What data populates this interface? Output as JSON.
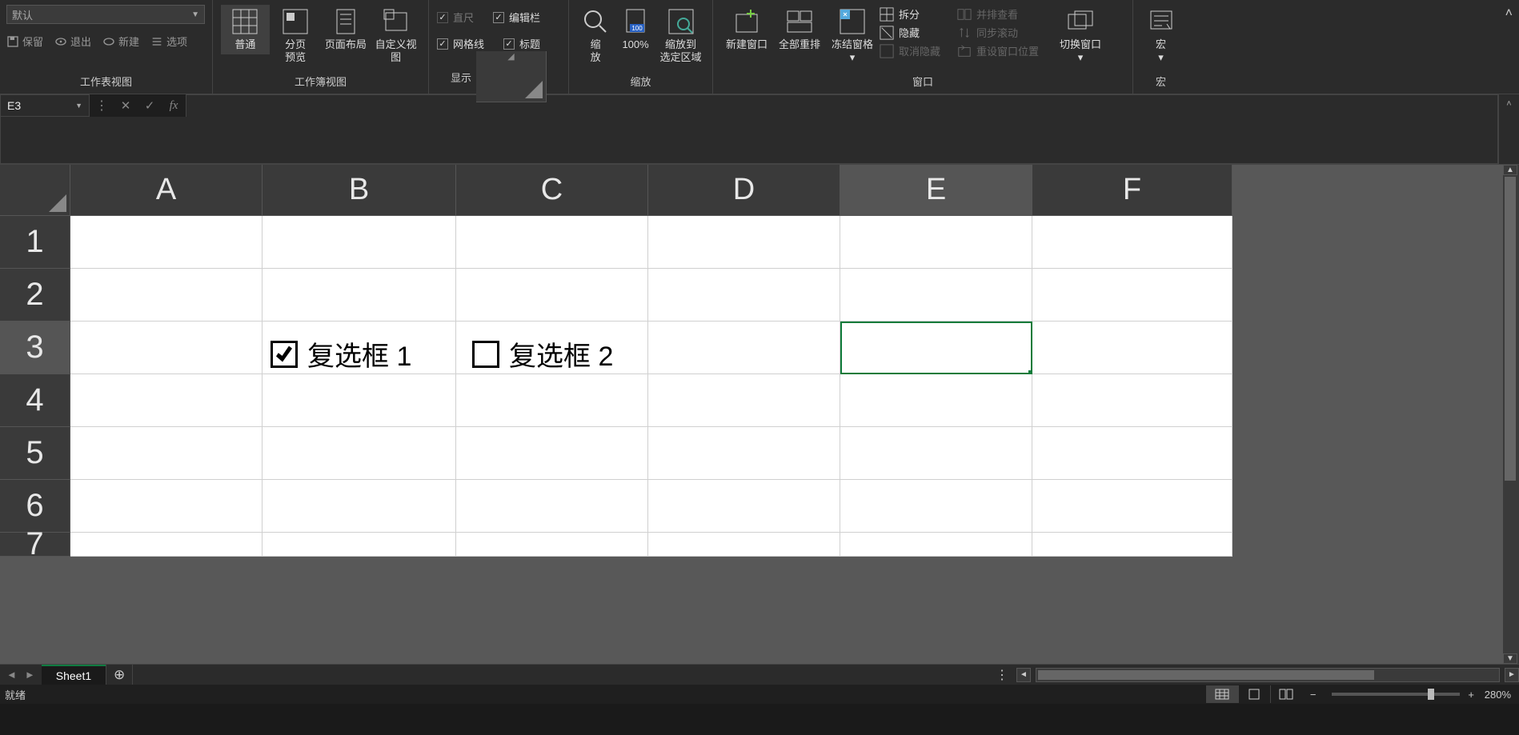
{
  "ribbon": {
    "zoom_select": "默认",
    "left_actions": {
      "save": "保留",
      "exit": "退出",
      "new": "新建",
      "options": "选项"
    },
    "group_worksheet_view": "工作表视图",
    "view_buttons": {
      "normal": "普通",
      "pagebreak": "分页\n预览",
      "pagelayout": "页面布局",
      "custom": "自定义视图"
    },
    "group_workbook_view": "工作簿视图",
    "show": {
      "ruler": "直尺",
      "formula_bar": "编辑栏",
      "gridlines": "网格线",
      "headings": "标题"
    },
    "group_show": "显示",
    "zoom": {
      "zoom": "缩\n放",
      "hundred": "100%",
      "to_selection": "缩放到\n选定区域"
    },
    "group_zoom": "缩放",
    "window": {
      "new_window": "新建窗口",
      "arrange": "全部重排",
      "freeze": "冻结窗格",
      "split": "拆分",
      "hide": "隐藏",
      "unhide": "取消隐藏",
      "side_by_side": "并排查看",
      "sync_scroll": "同步滚动",
      "reset_pos": "重设窗口位置",
      "switch": "切换窗口"
    },
    "group_window": "窗口",
    "macro": "宏",
    "group_macro": "宏"
  },
  "formula_bar": {
    "cell_ref": "E3",
    "fx": "fx"
  },
  "grid": {
    "cols": [
      "A",
      "B",
      "C",
      "D",
      "E",
      "F"
    ],
    "rows": [
      "1",
      "2",
      "3",
      "4",
      "5",
      "6",
      "7"
    ],
    "selected_cell": "E3",
    "checkbox1": "复选框 1",
    "checkbox2": "复选框 2"
  },
  "tabs": {
    "sheet1": "Sheet1"
  },
  "status": {
    "ready": "就绪",
    "zoom": "280%"
  }
}
